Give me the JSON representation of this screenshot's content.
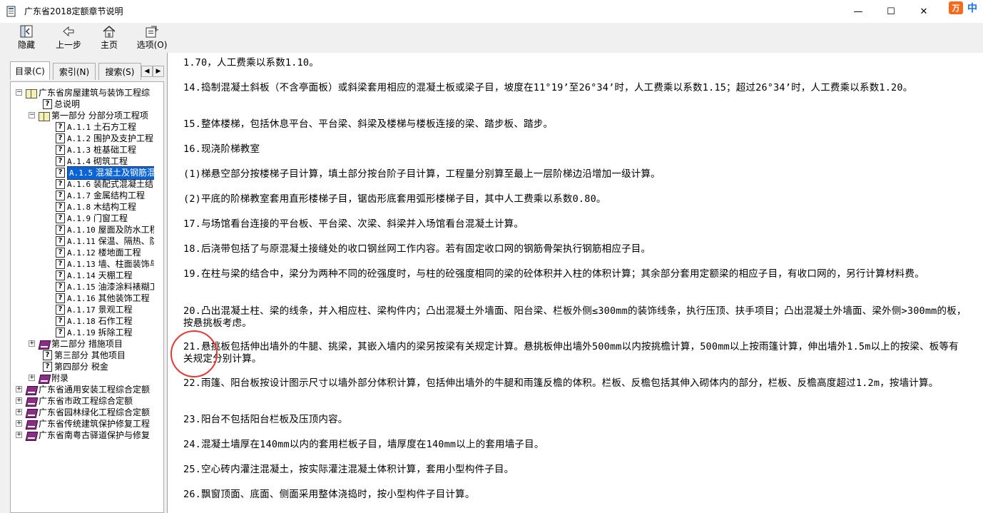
{
  "window": {
    "title": "广东省2018定额章节说明",
    "min_glyph": "—",
    "max_glyph": "☐",
    "close_glyph": "✕",
    "ime_badge": "万",
    "ime_lang": "中"
  },
  "toolbar": {
    "hide_label": "隐藏",
    "back_label": "上一步",
    "home_label": "主页",
    "options_label": "选项(O)"
  },
  "tabs": {
    "contents": "目录(C)",
    "index": "索引(N)",
    "search": "搜索(S)",
    "scroll_left": "◀",
    "scroll_right": "▶"
  },
  "tree": {
    "root": "广东省房屋建筑与装饰工程综",
    "general": "总说明",
    "part1": "第一部分 分部分项工程项",
    "items": [
      {
        "code": "A.1.1",
        "name": "土石方工程"
      },
      {
        "code": "A.1.2",
        "name": "围护及支护工程"
      },
      {
        "code": "A.1.3",
        "name": "桩基础工程"
      },
      {
        "code": "A.1.4",
        "name": "砌筑工程"
      },
      {
        "code": "A.1.5",
        "name": "混凝土及钢筋混"
      },
      {
        "code": "A.1.6",
        "name": "装配式混凝土结"
      },
      {
        "code": "A.1.7",
        "name": "金属结构工程"
      },
      {
        "code": "A.1.8",
        "name": "木结构工程"
      },
      {
        "code": "A.1.9",
        "name": "门窗工程"
      },
      {
        "code": "A.1.10",
        "name": "屋面及防水工程"
      },
      {
        "code": "A.1.11",
        "name": "保温、隔热、防"
      },
      {
        "code": "A.1.12",
        "name": "楼地面工程"
      },
      {
        "code": "A.1.13",
        "name": "墙、柱面装饰与"
      },
      {
        "code": "A.1.14",
        "name": "天棚工程"
      },
      {
        "code": "A.1.15",
        "name": "油漆涂料裱糊工"
      },
      {
        "code": "A.1.16",
        "name": "其他装饰工程"
      },
      {
        "code": "A.1.17",
        "name": "景观工程"
      },
      {
        "code": "A.1.18",
        "name": "石作工程"
      },
      {
        "code": "A.1.19",
        "name": "拆除工程"
      }
    ],
    "part2": "第二部分 措施项目",
    "part3": "第三部分 其他项目",
    "part4": "第四部分 税金",
    "appendix": "附录",
    "others": [
      "广东省通用安装工程综合定额",
      "广东省市政工程综合定额",
      "广东省园林绿化工程综合定额",
      "广东省传统建筑保护修复工程",
      "广东省南粤古驿道保护与修复"
    ]
  },
  "content": {
    "paragraphs": [
      "1.70，人工费乘以系数1.10。",
      "14.捣制混凝土斜板（不含亭面板）或斜梁套用相应的混凝土板或梁子目，坡度在11°19’至26°34’时，人工费乘以系数1.15；超过26°34’时，人工费乘以系数1.20。",
      "15.整体楼梯，包括休息平台、平台梁、斜梁及楼梯与楼板连接的梁、踏步板、踏步。",
      "16.现浇阶梯教室",
      "(1)梯悬空部分按楼梯子目计算，填土部分按台阶子目计算，工程量分别算至最上一层阶梯边沿增加一级计算。",
      "(2)平底的阶梯教室套用直形楼梯子目，锯齿形底套用弧形楼梯子目，其中人工费乘以系数0.80。",
      "17.与场馆看台连接的平台板、平台梁、次梁、斜梁并入场馆看台混凝土计算。",
      "18.后浇带包括了与原混凝土接缝处的收口钢丝网工作内容。若有固定收口网的钢筋骨架执行钢筋相应子目。",
      "19.在柱与梁的结合中，梁分为两种不同的砼强度时，与柱的砼强度相同的梁的砼体积并入柱的体积计算；其余部分套用定额梁的相应子目，有收口网的，另行计算材料费。",
      "20.凸出混凝土柱、梁的线条，并入相应柱、梁构件内；凸出混凝土外墙面、阳台梁、栏板外侧≤300mm的装饰线条，执行压顶、扶手项目；凸出混凝土外墙面、梁外侧>300mm的板，按悬挑板考虑。",
      "21.悬挑板包括伸出墙外的牛腿、挑梁，其嵌入墙内的梁另按梁有关规定计算。悬挑板伸出墙外500mm以内按挑檐计算，500mm以上按雨篷计算，伸出墙外1.5m以上的按梁、板等有关规定分别计算。",
      "22.雨篷、阳台板按设计图示尺寸以墙外部分体积计算，包括伸出墙外的牛腿和雨篷反檐的体积。栏板、反檐包括其伸入砌体内的部分，栏板、反檐高度超过1.2m，按墙计算。",
      "23.阳台不包括阳台栏板及压顶内容。",
      "24.混凝土墙厚在140mm以内的套用栏板子目，墙厚度在140mm以上的套用墙子目。",
      "25.空心砖内灌注混凝土，按实际灌注混凝土体积计算，套用小型构件子目。",
      "26.飘窗顶面、底面、侧面采用整体浇捣时，按小型构件子目计算。"
    ]
  },
  "colors": {
    "selection": "#0a64d6",
    "annotation_circle": "#e53935",
    "closed_book": "#8b2d86"
  }
}
